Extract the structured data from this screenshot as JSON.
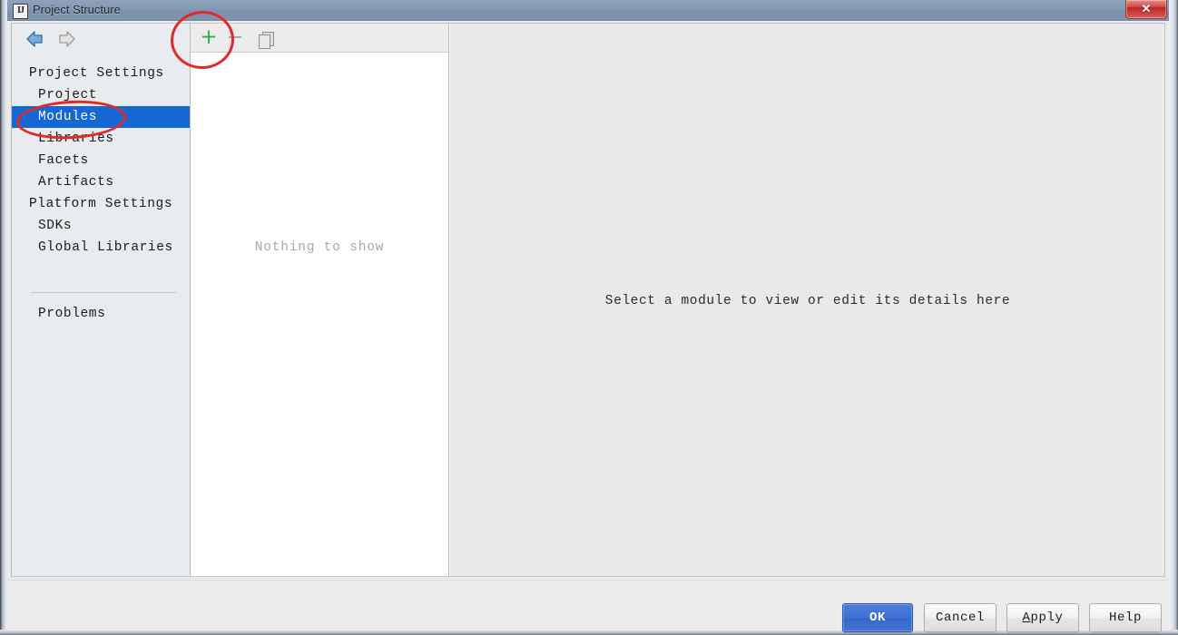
{
  "window": {
    "title": "Project Structure",
    "app_icon": "intellij-idea-icon",
    "close_label": "✕"
  },
  "nav": {
    "back_icon": "arrow-left-icon",
    "forward_icon": "arrow-right-icon"
  },
  "sidebar": {
    "groups": [
      {
        "header": "Project Settings",
        "items": [
          {
            "label": "Project",
            "selected": false
          },
          {
            "label": "Modules",
            "selected": true
          },
          {
            "label": "Libraries",
            "selected": false
          },
          {
            "label": "Facets",
            "selected": false
          },
          {
            "label": "Artifacts",
            "selected": false
          }
        ]
      },
      {
        "header": "Platform Settings",
        "items": [
          {
            "label": "SDKs",
            "selected": false
          },
          {
            "label": "Global Libraries",
            "selected": false
          }
        ]
      }
    ],
    "problems": "Problems"
  },
  "middle_panel": {
    "toolbar": {
      "add_icon": "plus-icon",
      "add_tooltip": "Add",
      "remove_icon": "minus-icon",
      "remove_tooltip": "Remove",
      "copy_icon": "copy-icon",
      "copy_tooltip": "Copy"
    },
    "empty_text": "Nothing to show"
  },
  "right_panel": {
    "message": "Select a module to view or edit its details here"
  },
  "footer": {
    "buttons": [
      {
        "label": "OK",
        "style": "primary"
      },
      {
        "label": "Cancel",
        "style": "normal"
      },
      {
        "label": "Apply",
        "style": "normal",
        "mnemonic": "A"
      },
      {
        "label": "Help",
        "style": "normal"
      }
    ],
    "ok_label": "OK",
    "cancel_label": "Cancel",
    "apply_label": "pply",
    "apply_mnemonic": "A",
    "help_label": "Help"
  },
  "annotations": [
    {
      "name": "highlight-add-button",
      "shape": "ellipse",
      "color": "#e02a2a"
    },
    {
      "name": "highlight-modules-item",
      "shape": "ellipse",
      "color": "#e02a2a"
    }
  ],
  "colors": {
    "selection_blue": "#1568d3",
    "primary_button": "#3f6fd2",
    "annotation_red": "#e02a2a",
    "add_icon_green": "#2faa52",
    "titlebar_blue": "#8399b2"
  }
}
